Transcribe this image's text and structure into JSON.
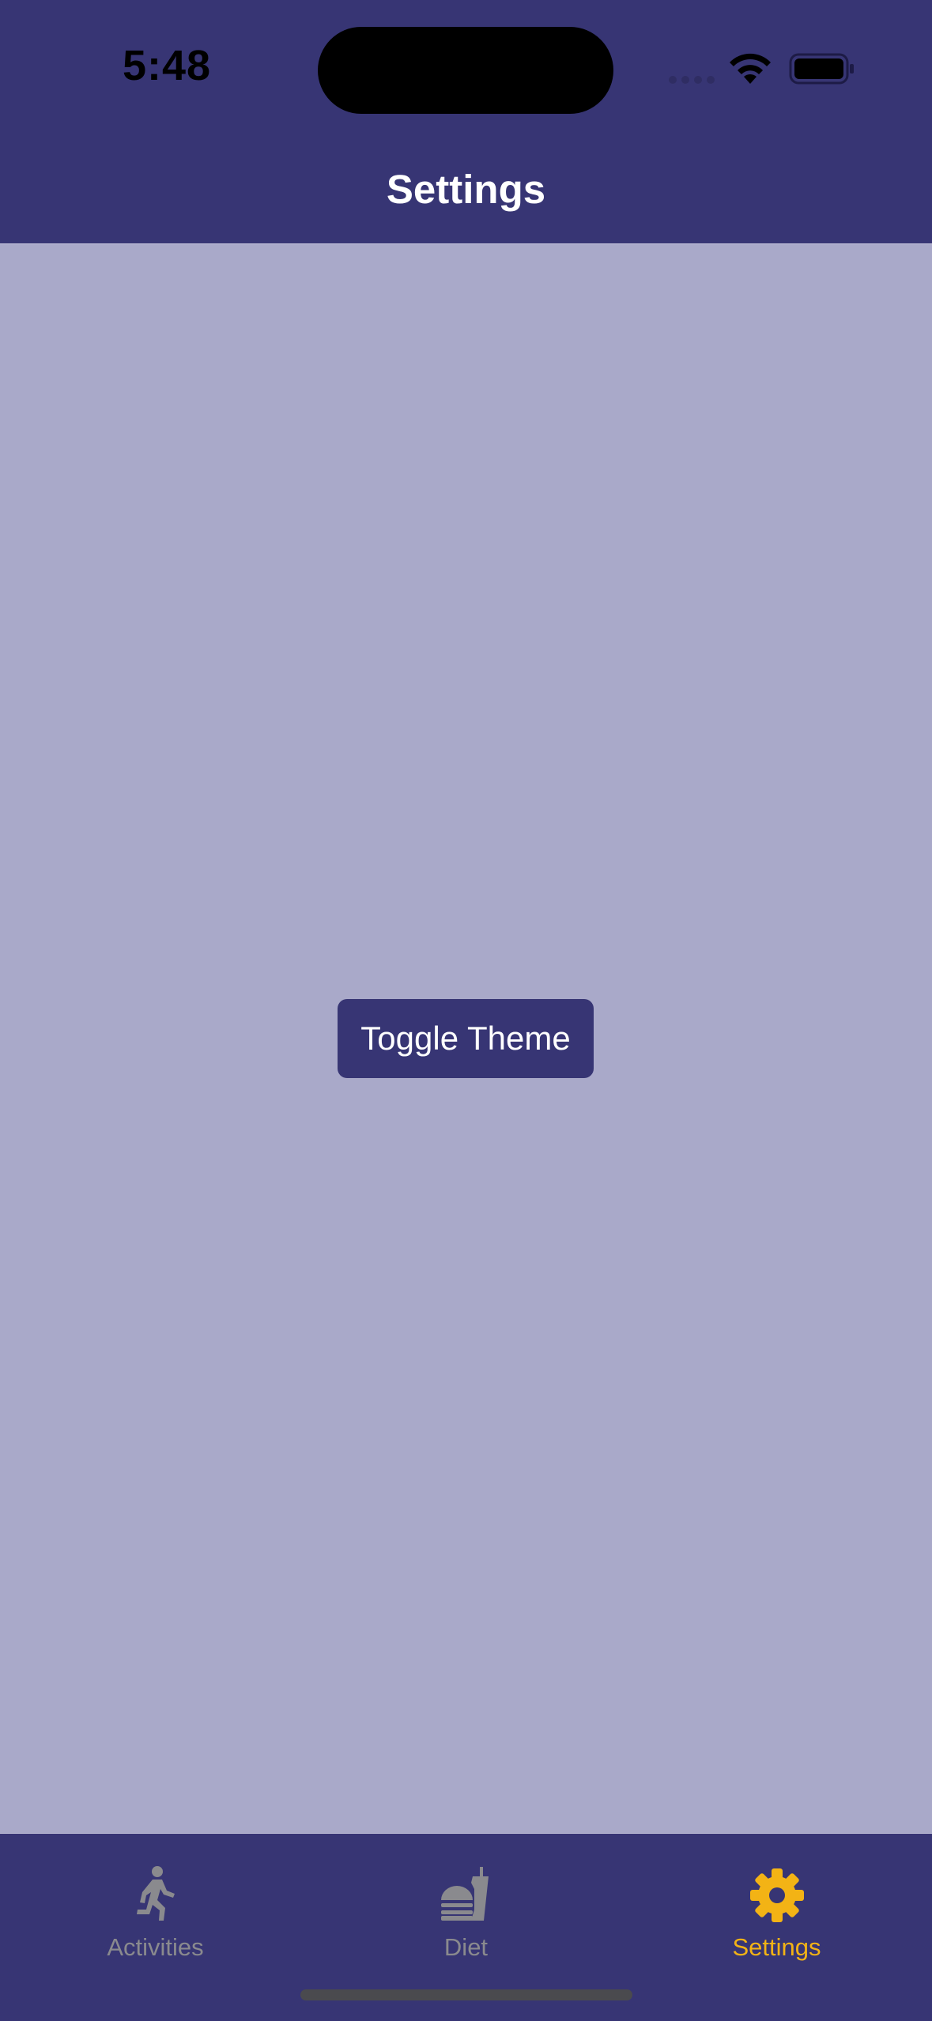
{
  "status_bar": {
    "time": "5:48",
    "icons": [
      "signal-icon",
      "wifi-icon",
      "battery-icon"
    ]
  },
  "nav": {
    "title": "Settings"
  },
  "main": {
    "toggle_button_label": "Toggle Theme"
  },
  "tabs": [
    {
      "label": "Activities",
      "icon": "running-person-icon",
      "active": false
    },
    {
      "label": "Diet",
      "icon": "fast-food-icon",
      "active": false
    },
    {
      "label": "Settings",
      "icon": "gear-icon",
      "active": true
    }
  ],
  "colors": {
    "header_background": "#373574",
    "content_background": "#a9a9c9",
    "button_background": "#373574",
    "active_tab": "#f3b315",
    "inactive_tab": "#8a8a8e"
  }
}
